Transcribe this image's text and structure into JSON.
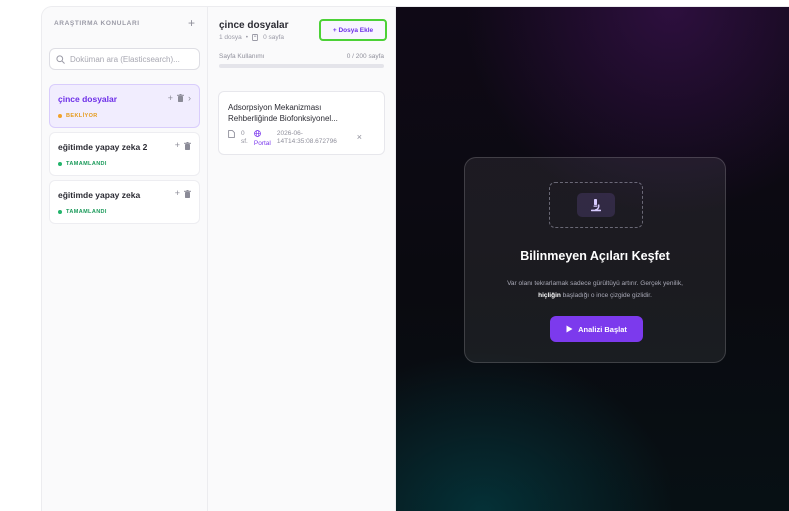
{
  "sidebar": {
    "title": "ARAŞTIRMA KONULARI",
    "add_icon": "plus-icon",
    "search": {
      "placeholder": "Doküman ara (Elasticsearch)...",
      "value": "",
      "icon": "search-icon"
    },
    "topics": [
      {
        "name": "çince dosyalar",
        "status": "BEKLİYOR",
        "active": true
      },
      {
        "name": "eğitimde yapay zeka 2",
        "status": "TAMAMLANDI",
        "active": false
      },
      {
        "name": "eğitimde yapay zeka",
        "status": "TAMAMLANDI",
        "active": false
      }
    ]
  },
  "files": {
    "title": "çince dosyalar",
    "count_text": "1 dosya",
    "pages_text": "0 sayfa",
    "add_button": "+ Dosya Ekle",
    "usage_label": "Sayfa Kullanımı",
    "usage_value": "0 / 200 sayfa",
    "usage_fraction": 0,
    "card": {
      "title": "Adsorpsiyon Mekanizması Rehberliğinde Biofonksiyonel...",
      "pages_num": "0",
      "pages_unit": "sf.",
      "source": "Portal",
      "date_line1": "2026-06-",
      "date_line2": "14T14:35:08.672796"
    }
  },
  "main": {
    "title": "Bilinmeyen Açıları Keşfet",
    "desc_part1": "Var olanı tekrarlamak sadece gürültüyü artırır. Gerçek yenilik,",
    "desc_bold": "hiçliğin",
    "desc_part2": "başladığı o ince çizgide gizlidir.",
    "button": "Analizi Başlat",
    "icons": {
      "hero": "microscope-icon",
      "button": "play-icon"
    }
  },
  "colors": {
    "accent": "#7c3aed",
    "status_waiting": "#f2a22b",
    "status_done": "#22b46b",
    "highlight_border": "#4cd137"
  }
}
